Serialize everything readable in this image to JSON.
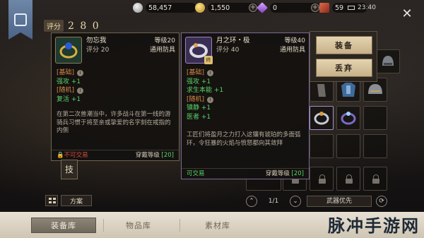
{
  "header": {
    "score_label": "评分",
    "score_value": "2 8 0",
    "resources": [
      {
        "icon": "silver-coin-icon",
        "value": "58,457"
      },
      {
        "icon": "gold-coin-icon",
        "value": "1,550"
      },
      {
        "icon": "purple-gem-icon",
        "value": "0"
      }
    ],
    "stamina": {
      "icon": "stamina-icon",
      "value": "59"
    },
    "time": "23:40"
  },
  "tooltip_left": {
    "name": "勿忘我",
    "score": "评分 20",
    "level": "等级20",
    "category": "通用防具",
    "section_base": "[基础]",
    "base_stats": [
      "强攻 +1"
    ],
    "section_random": "[随机]",
    "random_stats": [
      "复活 +1"
    ],
    "lore": "在第二次兽潮当中，许多战斗在第一线的游骑兵习惯于将至亲或挚爱的名字刻在戒指的内侧",
    "trade_status": "不可交易",
    "wear_label": "穿戴等级",
    "wear_level": "[20]"
  },
  "tooltip_right": {
    "name": "月之环・极",
    "score": "评分 40",
    "level": "等级40",
    "category": "通用防具",
    "section_base": "[基础]",
    "base_stats": [
      "强攻 +1",
      "求生本能 +1"
    ],
    "section_random": "[随机]",
    "random_stats": [
      "镇静 +1",
      "医者 +1"
    ],
    "lore": "工匠们将盈月之力打入这镶有琥珀的多面弧环，令狂暴的火焰与愤怒都向其敛拜",
    "trade_status": "可交易",
    "wear_label": "穿戴等级",
    "wear_level": "[20]",
    "badge": "终"
  },
  "actions": {
    "equip": "装备",
    "discard": "丢弃"
  },
  "skill_label": "技",
  "bottom_left": {
    "plan": "方案"
  },
  "pager": {
    "page": "1/1",
    "filter": "武器优先"
  },
  "tabs": [
    {
      "label": "装备库",
      "active": true
    },
    {
      "label": "物品库",
      "active": false
    },
    {
      "label": "素材库",
      "active": false
    }
  ],
  "watermark": "脉冲手游网",
  "colors": {
    "stat_green": "#5bd36a",
    "section_orange": "#d88b46",
    "untradeable_red": "#d8483d"
  }
}
